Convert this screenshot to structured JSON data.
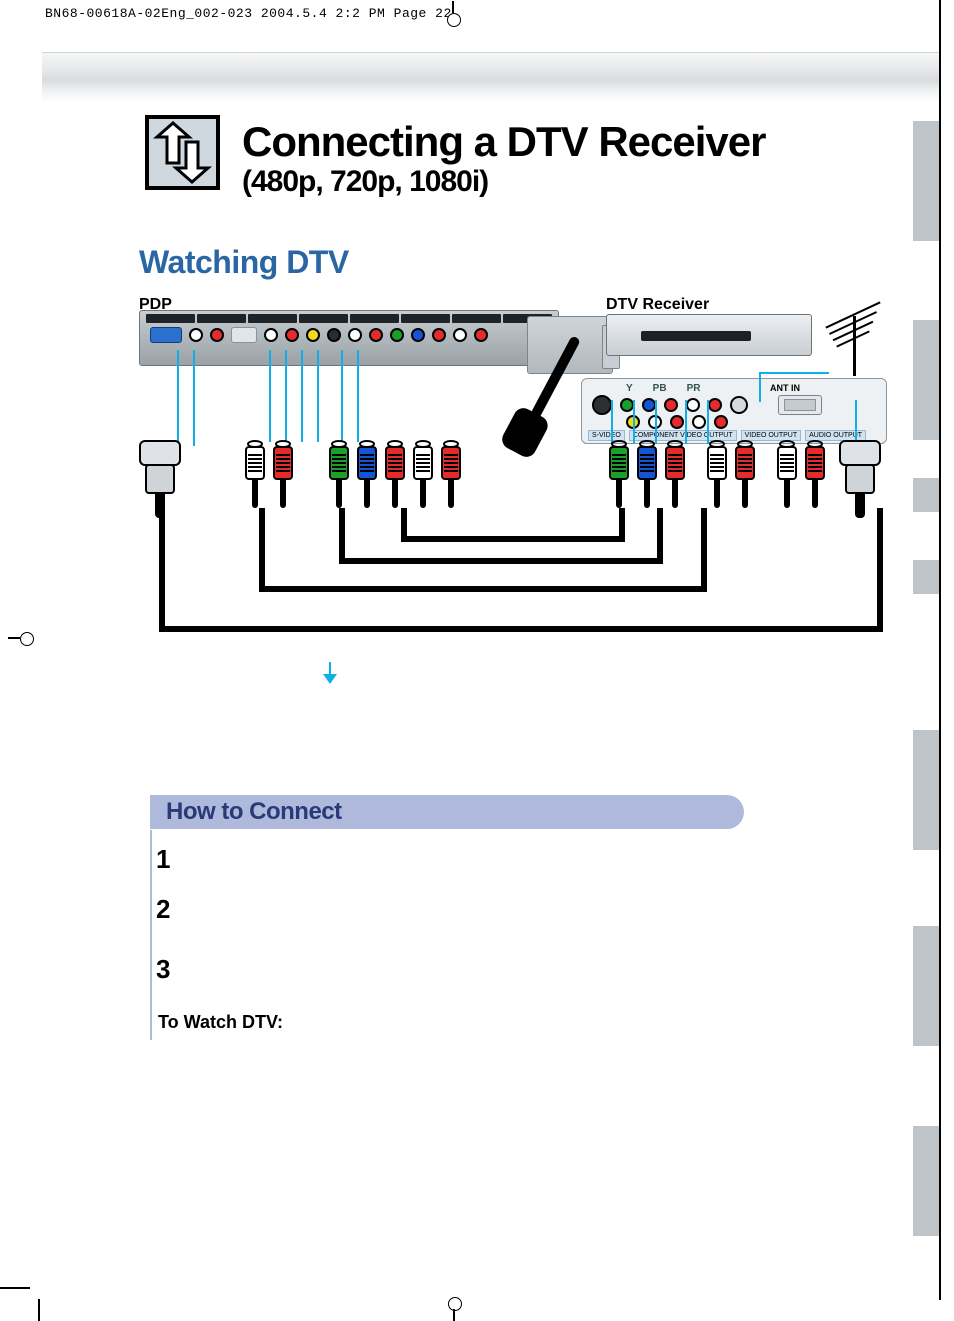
{
  "print_slug": "BN68-00618A-02Eng_002-023  2004.5.4  2:2 PM  Page 22",
  "title": {
    "main": "Connecting a DTV Receiver",
    "sub": "(480p, 720p, 1080i)"
  },
  "section_heading": "Watching DTV",
  "diagram": {
    "labels": {
      "pdp": "PDP",
      "dtv_receiver": "DTV Receiver"
    },
    "receiver_panel": {
      "component_labels": [
        "Y",
        "PB",
        "PR"
      ],
      "ant_in_label": "ANT IN",
      "bottom_labels": [
        "S-VIDEO",
        "COMPONENT VIDEO OUTPUT",
        "VIDEO OUTPUT",
        "AUDIO OUTPUT"
      ]
    }
  },
  "how_to_connect": {
    "heading": "How to Connect",
    "steps": [
      {
        "num": "1"
      },
      {
        "num": "2"
      },
      {
        "num": "3"
      }
    ],
    "footer": "To Watch DTV:"
  }
}
